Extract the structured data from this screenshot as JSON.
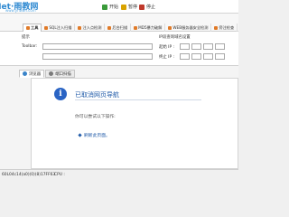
{
  "app": {
    "logo_text": "Net·雨教网",
    "logo_sub": "www.ynwan.com"
  },
  "toolbar": {
    "items": [
      {
        "label": "开始",
        "color": "#3a9b3a"
      },
      {
        "label": "暂停",
        "color": "#d9a300"
      },
      {
        "label": "停止",
        "color": "#c0392b"
      }
    ]
  },
  "menu": {
    "tabs": [
      {
        "label": "工具",
        "active": true
      },
      {
        "label": "SQL注入扫描",
        "active": false
      },
      {
        "label": "注入点检测",
        "active": false
      },
      {
        "label": "后台扫描",
        "active": false
      },
      {
        "label": "MD5暴力破解",
        "active": false
      },
      {
        "label": "WEB服务器安全检测",
        "active": false
      },
      {
        "label": "旁注检查",
        "active": false
      }
    ]
  },
  "form": {
    "host_label": "提示",
    "toolbar_label": "Toolbar:",
    "ip_group_label": "IP段查询域名设置",
    "start_ip_label": "起始 IP :",
    "end_ip_label": "终止 IP :"
  },
  "browser": {
    "tabs": [
      {
        "label": "浏览器",
        "active": true
      },
      {
        "label": "端口扫描",
        "active": false
      }
    ],
    "info_title": "已取消网页导航",
    "info_sub": "你可以尝试以下操作:",
    "info_link": "刷新此页面。"
  },
  "status": {
    "text": "60L04c14(a0)(0)(8)17FF63",
    "cpu": "CPU :"
  }
}
